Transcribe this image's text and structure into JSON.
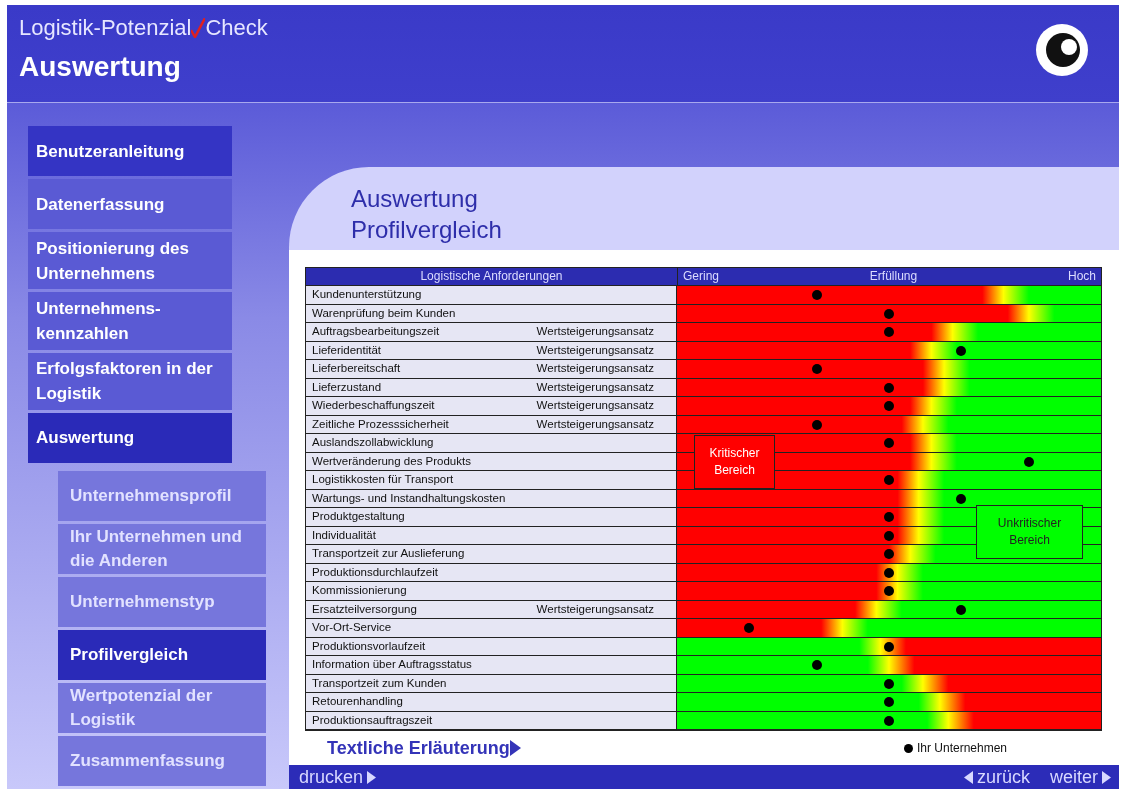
{
  "header": {
    "app_title_start": "Logistik-Potenzial",
    "app_title_end": "Check",
    "section_title": "Auswertung"
  },
  "sidebar": {
    "items": [
      {
        "label": "Benutzeranleitung",
        "selected": false
      },
      {
        "label": "Datenerfassung",
        "selected": false
      },
      {
        "label": "Positionierung des Unternehmens",
        "selected": false
      },
      {
        "label": "Unternehmens-kennzahlen",
        "selected": false
      },
      {
        "label": "Erfolgsfaktoren in der Logistik",
        "selected": false
      },
      {
        "label": "Auswertung",
        "selected": true,
        "children": [
          {
            "label": "Unternehmensprofil",
            "selected": false
          },
          {
            "label": "Ihr Unternehmen und die Anderen",
            "selected": false
          },
          {
            "label": "Unternehmenstyp",
            "selected": false
          },
          {
            "label": "Profilvergleich",
            "selected": true
          },
          {
            "label": "Wertpotenzial der Logistik",
            "selected": false
          },
          {
            "label": "Zusammenfassung",
            "selected": false
          }
        ]
      }
    ]
  },
  "page": {
    "title_line_1": "Auswertung",
    "title_line_2": "Profilvergleich"
  },
  "table": {
    "column_1": "Logistische Anforderungen",
    "scale_low": "Gering",
    "scale_title": "Erfüllung",
    "scale_high": "Hoch",
    "rows": [
      {
        "name": "Kundenunterstützung",
        "kind": "rising",
        "level": 0.33
      },
      {
        "name": "Warenprüfung beim Kunden",
        "kind": "rising",
        "level": 0.5
      },
      {
        "name": "Auftragsbearbeitungszeit",
        "tag": "Wertsteigerungsansatz",
        "kind": "rising",
        "level": 0.5
      },
      {
        "name": "Lieferidentität",
        "tag": "Wertsteigerungsansatz",
        "kind": "rising",
        "level": 0.67
      },
      {
        "name": "Lieferbereitschaft",
        "tag": "Wertsteigerungsansatz",
        "kind": "rising",
        "level": 0.33
      },
      {
        "name": "Lieferzustand",
        "tag": "Wertsteigerungsansatz",
        "kind": "rising",
        "level": 0.5
      },
      {
        "name": "Wiederbeschaffungszeit",
        "tag": "Wertsteigerungsansatz",
        "kind": "rising",
        "level": 0.5
      },
      {
        "name": "Zeitliche Prozesssicherheit",
        "tag": "Wertsteigerungsansatz",
        "kind": "rising",
        "level": 0.33
      },
      {
        "name": "Auslandszollabwicklung",
        "kind": "rising",
        "level": 0.5
      },
      {
        "name": "Wertveränderung des Produkts",
        "kind": "rising",
        "level": 0.83
      },
      {
        "name": "Logistikkosten für Transport",
        "kind": "rising",
        "level": 0.5
      },
      {
        "name": "Wartungs- und Instandhaltungskosten",
        "kind": "rising",
        "level": 0.67
      },
      {
        "name": "Produktgestaltung",
        "kind": "rising",
        "level": 0.5
      },
      {
        "name": "Individualität",
        "kind": "rising",
        "level": 0.5
      },
      {
        "name": "Transportzeit zur Auslieferung",
        "kind": "rising",
        "level": 0.5
      },
      {
        "name": "Produktionsdurchlaufzeit",
        "kind": "rising",
        "level": 0.5
      },
      {
        "name": "Kommissionierung",
        "kind": "rising",
        "level": 0.5
      },
      {
        "name": "Ersatzteilversorgung",
        "tag": "Wertsteigerungsansatz",
        "kind": "rising",
        "level": 0.67
      },
      {
        "name": "Vor-Ort-Service",
        "kind": "rising",
        "level": 0.17
      },
      {
        "name": "Produktionsvorlaufzeit",
        "kind": "falling",
        "level": 0.5
      },
      {
        "name": "Information über Auftragsstatus",
        "kind": "falling",
        "level": 0.33
      },
      {
        "name": "Transportzeit zum Kunden",
        "kind": "falling",
        "level": 0.5
      },
      {
        "name": "Retourenhandling",
        "kind": "falling",
        "level": 0.5
      },
      {
        "name": "Produktionsauftragszeit",
        "kind": "falling",
        "level": 0.5
      }
    ],
    "critical_zone": {
      "line_1": "Kritischer",
      "line_2": "Bereich"
    },
    "uncritical_zone": {
      "line_1": "Unkritischer",
      "line_2": "Bereich"
    }
  },
  "footer": {
    "explanation_link": "Textliche Erläuterung",
    "legend": "Ihr Unternehmen"
  },
  "bottom_bar": {
    "print": "drucken",
    "back": "zurück",
    "next": "weiter"
  }
}
